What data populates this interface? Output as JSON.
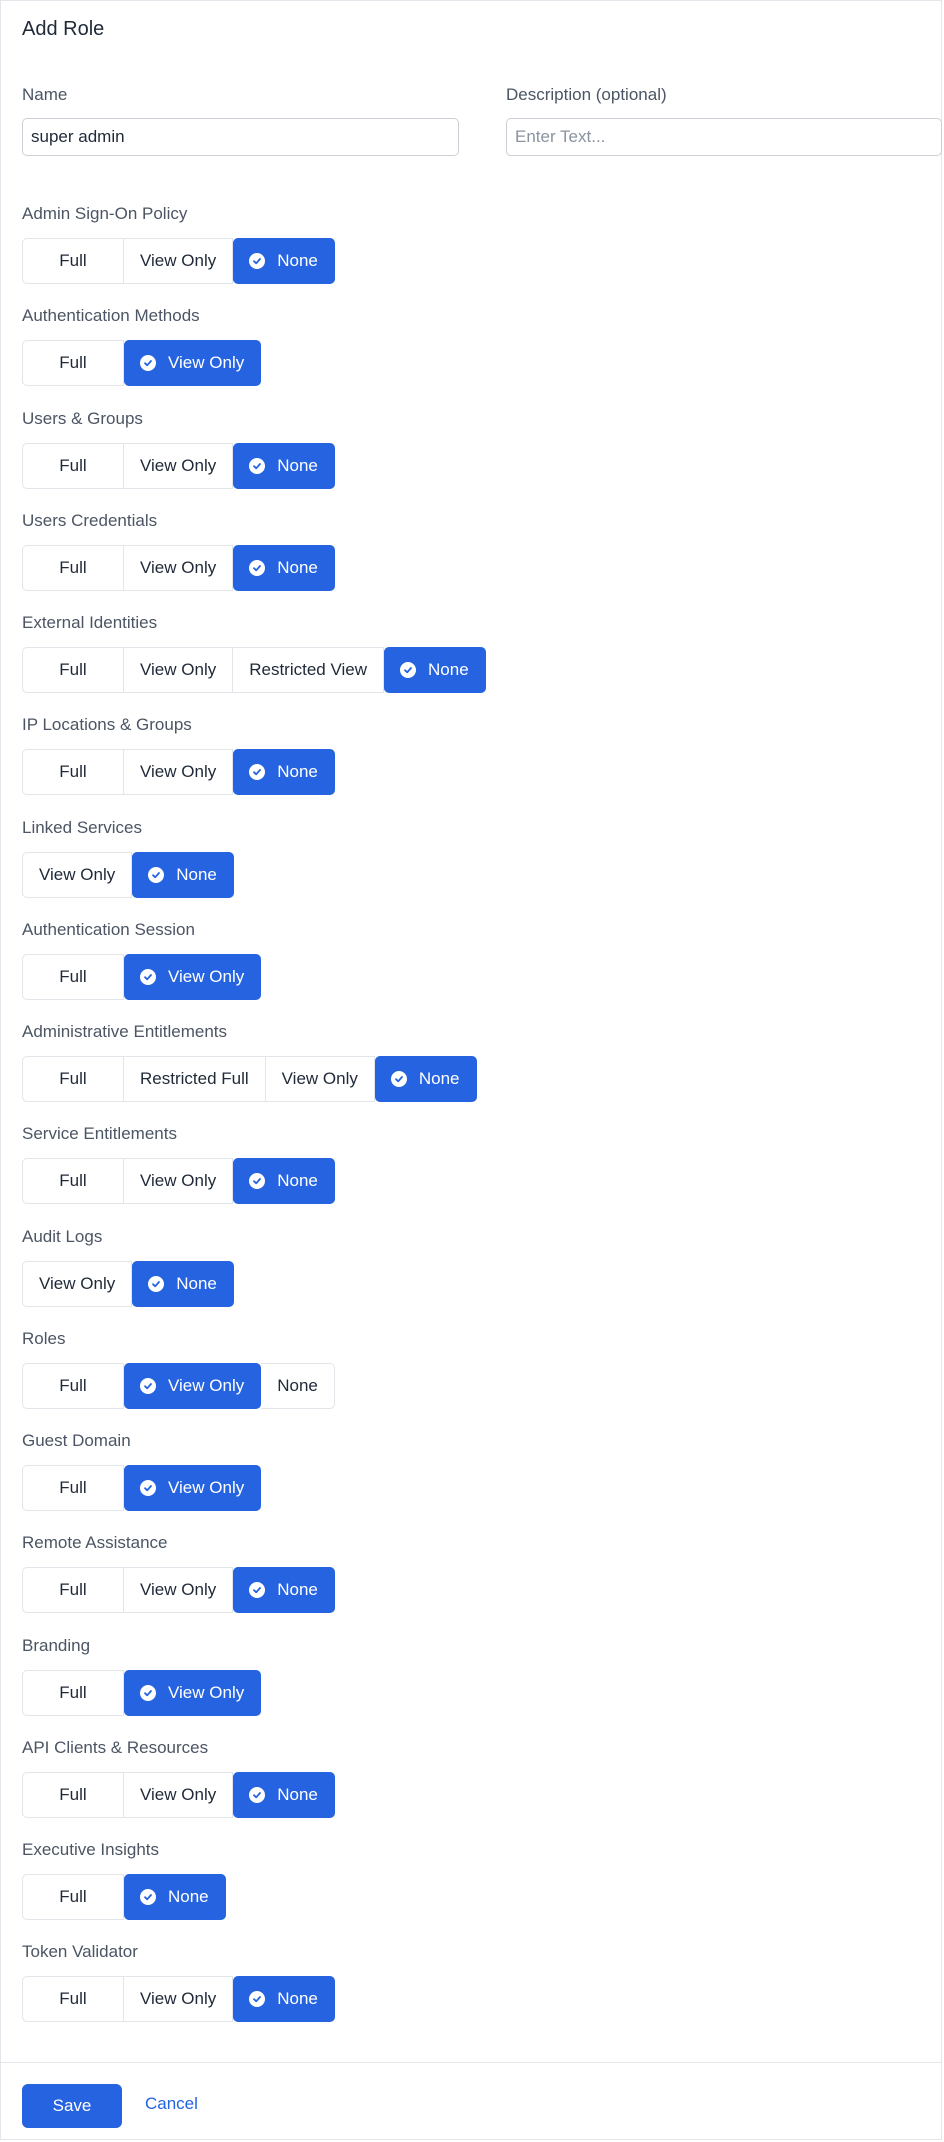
{
  "dialog": {
    "title": "Add Role"
  },
  "name_field": {
    "label": "Name",
    "value": "super admin"
  },
  "description_field": {
    "label": "Description (optional)",
    "value": "",
    "placeholder": "Enter Text..."
  },
  "accent_color": "#2563e0",
  "selected_icon": "check-circle-icon",
  "sections": [
    {
      "label": "Admin Sign-On Policy",
      "options": [
        "Full",
        "View Only",
        "None"
      ],
      "selected": "None"
    },
    {
      "label": "Authentication Methods",
      "options": [
        "Full",
        "View Only"
      ],
      "selected": "View Only"
    },
    {
      "label": "Users & Groups",
      "options": [
        "Full",
        "View Only",
        "None"
      ],
      "selected": "None"
    },
    {
      "label": "Users Credentials",
      "options": [
        "Full",
        "View Only",
        "None"
      ],
      "selected": "None"
    },
    {
      "label": "External Identities",
      "options": [
        "Full",
        "View Only",
        "Restricted View",
        "None"
      ],
      "selected": "None"
    },
    {
      "label": "IP Locations & Groups",
      "options": [
        "Full",
        "View Only",
        "None"
      ],
      "selected": "None"
    },
    {
      "label": "Linked Services",
      "options": [
        "View Only",
        "None"
      ],
      "selected": "None"
    },
    {
      "label": "Authentication Session",
      "options": [
        "Full",
        "View Only"
      ],
      "selected": "View Only"
    },
    {
      "label": "Administrative Entitlements",
      "options": [
        "Full",
        "Restricted Full",
        "View Only",
        "None"
      ],
      "selected": "None"
    },
    {
      "label": "Service Entitlements",
      "options": [
        "Full",
        "View Only",
        "None"
      ],
      "selected": "None"
    },
    {
      "label": "Audit Logs",
      "options": [
        "View Only",
        "None"
      ],
      "selected": "None"
    },
    {
      "label": "Roles",
      "options": [
        "Full",
        "View Only",
        "None"
      ],
      "selected": "View Only"
    },
    {
      "label": "Guest Domain",
      "options": [
        "Full",
        "View Only"
      ],
      "selected": "View Only"
    },
    {
      "label": "Remote Assistance",
      "options": [
        "Full",
        "View Only",
        "None"
      ],
      "selected": "None"
    },
    {
      "label": "Branding",
      "options": [
        "Full",
        "View Only"
      ],
      "selected": "View Only"
    },
    {
      "label": "API Clients & Resources",
      "options": [
        "Full",
        "View Only",
        "None"
      ],
      "selected": "None"
    },
    {
      "label": "Executive Insights",
      "options": [
        "Full",
        "None"
      ],
      "selected": "None"
    },
    {
      "label": "Token Validator",
      "options": [
        "Full",
        "View Only",
        "None"
      ],
      "selected": "None"
    }
  ],
  "footer": {
    "save_label": "Save",
    "cancel_label": "Cancel"
  }
}
